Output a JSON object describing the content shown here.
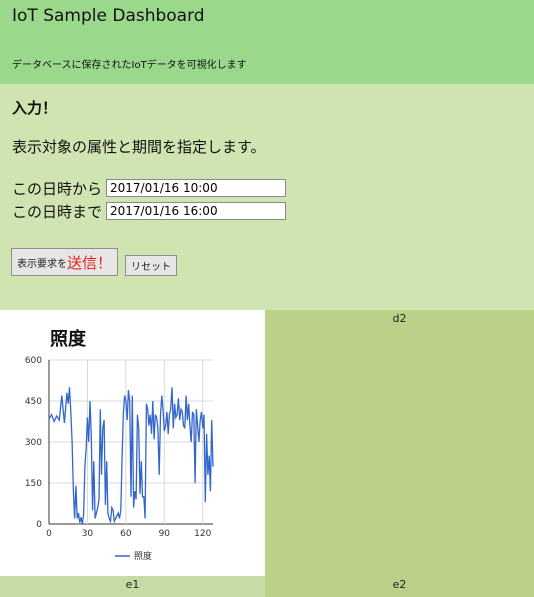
{
  "header": {
    "title": "IoT Sample Dashboard",
    "subtitle": "データベースに保存されたIoTデータを可視化します"
  },
  "form": {
    "heading": "入力！",
    "description": "表示対象の属性と期間を指定します。",
    "from_label": "この日時から",
    "from_value": "2017/01/16 10:00",
    "to_label": "この日時まで",
    "to_value": "2017/01/16 16:00",
    "submit_small": "表示要求を",
    "submit_big": "送信！",
    "reset_label": "リセット"
  },
  "panels": {
    "d2": "d2",
    "e1": "e1",
    "e2": "e2"
  },
  "colors": {
    "header_bg": "#9ad98c",
    "form_bg": "#cfe4b0",
    "panel_bg": "#bbd18a",
    "series_line": "#3366cc",
    "submit_accent": "#e81c1c"
  },
  "chart_data": {
    "type": "line",
    "title": "照度",
    "xlim": [
      0,
      128
    ],
    "ylim": [
      0,
      600
    ],
    "xticks": [
      0,
      30,
      60,
      90,
      120
    ],
    "yticks": [
      0,
      150,
      300,
      450,
      600
    ],
    "grid": true,
    "legend": "bottom",
    "series": [
      {
        "name": "照度",
        "x": [
          0,
          2,
          4,
          6,
          8,
          10,
          12,
          14,
          15,
          16,
          17,
          18,
          19,
          20,
          21,
          22,
          23,
          24,
          25,
          26,
          27,
          28,
          29,
          30,
          31,
          32,
          33,
          34,
          35,
          36,
          37,
          38,
          39,
          40,
          41,
          42,
          43,
          44,
          45,
          46,
          47,
          48,
          49,
          50,
          51,
          52,
          53,
          54,
          55,
          56,
          57,
          58,
          59,
          60,
          61,
          62,
          63,
          64,
          65,
          66,
          67,
          68,
          69,
          70,
          71,
          72,
          73,
          74,
          75,
          76,
          77,
          78,
          79,
          80,
          81,
          82,
          83,
          84,
          85,
          86,
          87,
          88,
          89,
          90,
          91,
          92,
          93,
          94,
          95,
          96,
          97,
          98,
          99,
          100,
          101,
          102,
          103,
          104,
          105,
          106,
          107,
          108,
          109,
          110,
          111,
          112,
          113,
          114,
          115,
          116,
          117,
          118,
          119,
          120,
          121,
          122,
          123,
          124,
          125,
          126,
          127,
          128
        ],
        "values": [
          385,
          400,
          375,
          395,
          380,
          470,
          370,
          480,
          440,
          500,
          410,
          300,
          130,
          20,
          140,
          20,
          40,
          5,
          25,
          0,
          35,
          210,
          280,
          390,
          300,
          450,
          320,
          50,
          230,
          20,
          40,
          60,
          90,
          420,
          180,
          350,
          380,
          70,
          230,
          40,
          20,
          10,
          60,
          50,
          10,
          20,
          30,
          40,
          20,
          50,
          230,
          400,
          470,
          450,
          380,
          490,
          450,
          100,
          470,
          60,
          120,
          90,
          400,
          350,
          110,
          230,
          100,
          100,
          20,
          440,
          420,
          360,
          400,
          330,
          450,
          310,
          400,
          390,
          350,
          180,
          400,
          470,
          420,
          340,
          360,
          410,
          330,
          400,
          420,
          500,
          350,
          440,
          390,
          400,
          460,
          380,
          420,
          410,
          360,
          350,
          470,
          380,
          440,
          360,
          300,
          410,
          400,
          150,
          420,
          360,
          300,
          380,
          410,
          350,
          400,
          80,
          330,
          180,
          250,
          120,
          380,
          210
        ]
      }
    ]
  }
}
